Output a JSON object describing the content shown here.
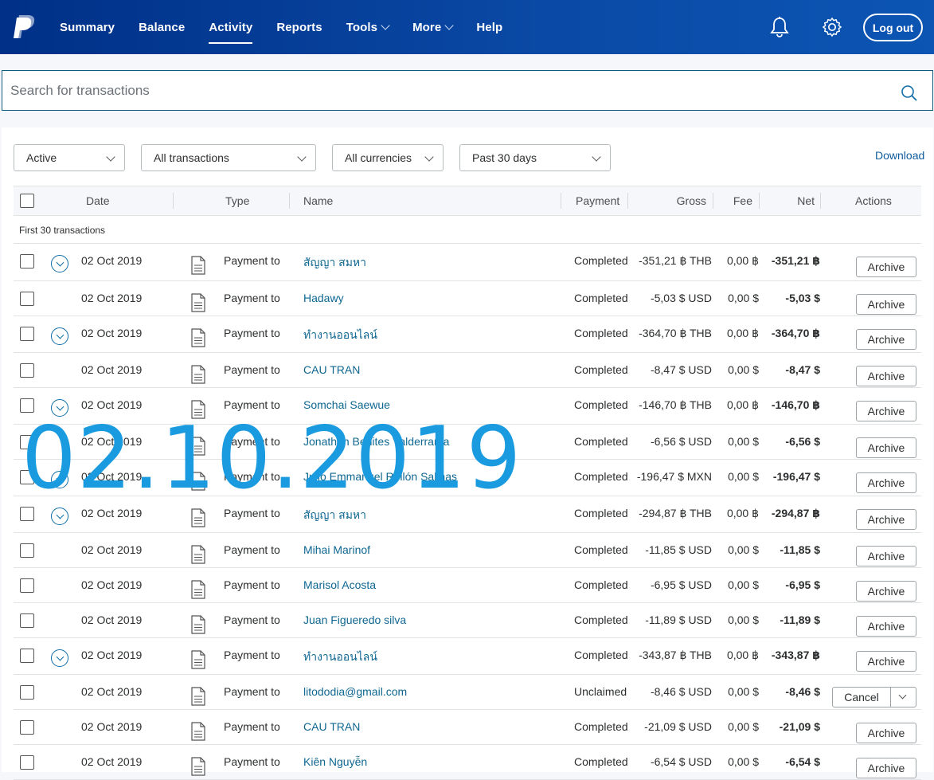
{
  "brand": {
    "colors": {
      "header": "#003087",
      "link": "#0f6791",
      "overlay": "#1a9be0"
    }
  },
  "nav": {
    "items": [
      {
        "label": "Summary"
      },
      {
        "label": "Balance"
      },
      {
        "label": "Activity",
        "active": true
      },
      {
        "label": "Reports"
      },
      {
        "label": "Tools",
        "dropdown": true
      },
      {
        "label": "More",
        "dropdown": true
      },
      {
        "label": "Help"
      }
    ],
    "logout_label": "Log out"
  },
  "search": {
    "placeholder": "Search for transactions"
  },
  "filters": {
    "status": "Active",
    "type": "All transactions",
    "currency": "All currencies",
    "period": "Past 30 days",
    "download_label": "Download"
  },
  "table": {
    "headers": {
      "date": "Date",
      "type": "Type",
      "name": "Name",
      "payment": "Payment",
      "gross": "Gross",
      "fee": "Fee",
      "net": "Net",
      "actions": "Actions"
    },
    "subheader": "First 30 transactions",
    "rows": [
      {
        "expand": true,
        "date": "02 Oct 2019",
        "type": "Payment to",
        "name": "สัญญา สมหา",
        "payment": "Completed",
        "gross": "-351,21 ฿ THB",
        "fee": "0,00 ฿",
        "net": "-351,21 ฿",
        "action": "Archive"
      },
      {
        "expand": false,
        "date": "02 Oct 2019",
        "type": "Payment to",
        "name": "Hadawy",
        "payment": "Completed",
        "gross": "-5,03 $ USD",
        "fee": "0,00 $",
        "net": "-5,03 $",
        "action": "Archive"
      },
      {
        "expand": true,
        "date": "02 Oct 2019",
        "type": "Payment to",
        "name": "ทำงานออนไลน์",
        "payment": "Completed",
        "gross": "-364,70 ฿ THB",
        "fee": "0,00 ฿",
        "net": "-364,70 ฿",
        "action": "Archive"
      },
      {
        "expand": false,
        "date": "02 Oct 2019",
        "type": "Payment to",
        "name": "CAU TRAN",
        "payment": "Completed",
        "gross": "-8,47 $ USD",
        "fee": "0,00 $",
        "net": "-8,47 $",
        "action": "Archive"
      },
      {
        "expand": true,
        "date": "02 Oct 2019",
        "type": "Payment to",
        "name": "Somchai Saewue",
        "payment": "Completed",
        "gross": "-146,70 ฿ THB",
        "fee": "0,00 ฿",
        "net": "-146,70 ฿",
        "action": "Archive"
      },
      {
        "expand": false,
        "date": "02 Oct 2019",
        "type": "Payment to",
        "name": "Jonathan Benites Valderrama",
        "payment": "Completed",
        "gross": "-6,56 $ USD",
        "fee": "0,00 $",
        "net": "-6,56 $",
        "action": "Archive"
      },
      {
        "expand": true,
        "date": "02 Oct 2019",
        "type": "Payment to",
        "name": "Julio Emmanuel Rellón Salinas",
        "payment": "Completed",
        "gross": "-196,47 $ MXN",
        "fee": "0,00 $",
        "net": "-196,47 $",
        "action": "Archive"
      },
      {
        "expand": true,
        "date": "02 Oct 2019",
        "type": "Payment to",
        "name": "สัญญา สมหา",
        "payment": "Completed",
        "gross": "-294,87 ฿ THB",
        "fee": "0,00 ฿",
        "net": "-294,87 ฿",
        "action": "Archive"
      },
      {
        "expand": false,
        "date": "02 Oct 2019",
        "type": "Payment to",
        "name": "Mihai Marinof",
        "payment": "Completed",
        "gross": "-11,85 $ USD",
        "fee": "0,00 $",
        "net": "-11,85 $",
        "action": "Archive"
      },
      {
        "expand": false,
        "date": "02 Oct 2019",
        "type": "Payment to",
        "name": "Marisol Acosta",
        "payment": "Completed",
        "gross": "-6,95 $ USD",
        "fee": "0,00 $",
        "net": "-6,95 $",
        "action": "Archive"
      },
      {
        "expand": false,
        "date": "02 Oct 2019",
        "type": "Payment to",
        "name": "Juan Figueredo silva",
        "payment": "Completed",
        "gross": "-11,89 $ USD",
        "fee": "0,00 $",
        "net": "-11,89 $",
        "action": "Archive"
      },
      {
        "expand": true,
        "date": "02 Oct 2019",
        "type": "Payment to",
        "name": "ทำงานออนไลน์",
        "payment": "Completed",
        "gross": "-343,87 ฿ THB",
        "fee": "0,00 ฿",
        "net": "-343,87 ฿",
        "action": "Archive"
      },
      {
        "expand": false,
        "date": "02 Oct 2019",
        "type": "Payment to",
        "name": "litododia@gmail.com",
        "payment": "Unclaimed",
        "gross": "-8,46 $ USD",
        "fee": "0,00 $",
        "net": "-8,46 $",
        "action": "Cancel",
        "action_dropdown": true
      },
      {
        "expand": false,
        "date": "02 Oct 2019",
        "type": "Payment to",
        "name": "CAU TRAN",
        "payment": "Completed",
        "gross": "-21,09 $ USD",
        "fee": "0,00 $",
        "net": "-21,09 $",
        "action": "Archive"
      },
      {
        "expand": false,
        "date": "02 Oct 2019",
        "type": "Payment to",
        "name": "Kiên Nguyễn",
        "payment": "Completed",
        "gross": "-6,54 $ USD",
        "fee": "0,00 $",
        "net": "-6,54 $",
        "action": "Archive"
      }
    ]
  },
  "overlay_text": "02.10.2019"
}
